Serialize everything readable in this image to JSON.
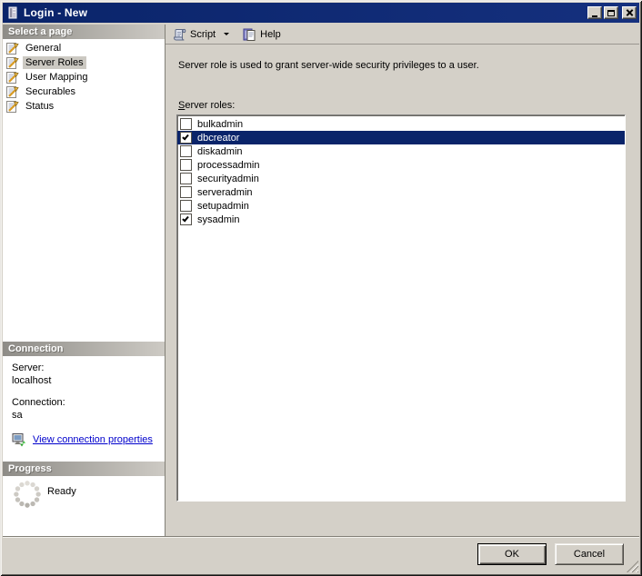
{
  "window": {
    "title": "Login - New"
  },
  "sidebar": {
    "select_page": {
      "header": "Select a page",
      "items": [
        {
          "label": "General",
          "selected": false
        },
        {
          "label": "Server Roles",
          "selected": true
        },
        {
          "label": "User Mapping",
          "selected": false
        },
        {
          "label": "Securables",
          "selected": false
        },
        {
          "label": "Status",
          "selected": false
        }
      ]
    },
    "connection": {
      "header": "Connection",
      "server_label": "Server:",
      "server_value": "localhost",
      "connection_label": "Connection:",
      "connection_value": "sa",
      "link_label": "View connection properties"
    },
    "progress": {
      "header": "Progress",
      "status": "Ready"
    }
  },
  "toolbar": {
    "script_label": "Script",
    "help_label": "Help"
  },
  "main": {
    "description": "Server role is used to grant server-wide security privileges to a user.",
    "roles_label_accel": "S",
    "roles_label_rest": "erver roles:",
    "roles": [
      {
        "name": "bulkadmin",
        "checked": false,
        "selected": false
      },
      {
        "name": "dbcreator",
        "checked": true,
        "selected": true
      },
      {
        "name": "diskadmin",
        "checked": false,
        "selected": false
      },
      {
        "name": "processadmin",
        "checked": false,
        "selected": false
      },
      {
        "name": "securityadmin",
        "checked": false,
        "selected": false
      },
      {
        "name": "serveradmin",
        "checked": false,
        "selected": false
      },
      {
        "name": "setupadmin",
        "checked": false,
        "selected": false
      },
      {
        "name": "sysadmin",
        "checked": true,
        "selected": false
      }
    ]
  },
  "footer": {
    "ok_label": "OK",
    "cancel_label": "Cancel"
  },
  "colors": {
    "titlebar": "#0a246a",
    "selection": "#0a246a",
    "background": "#d4d0c8",
    "link": "#0000cc"
  }
}
